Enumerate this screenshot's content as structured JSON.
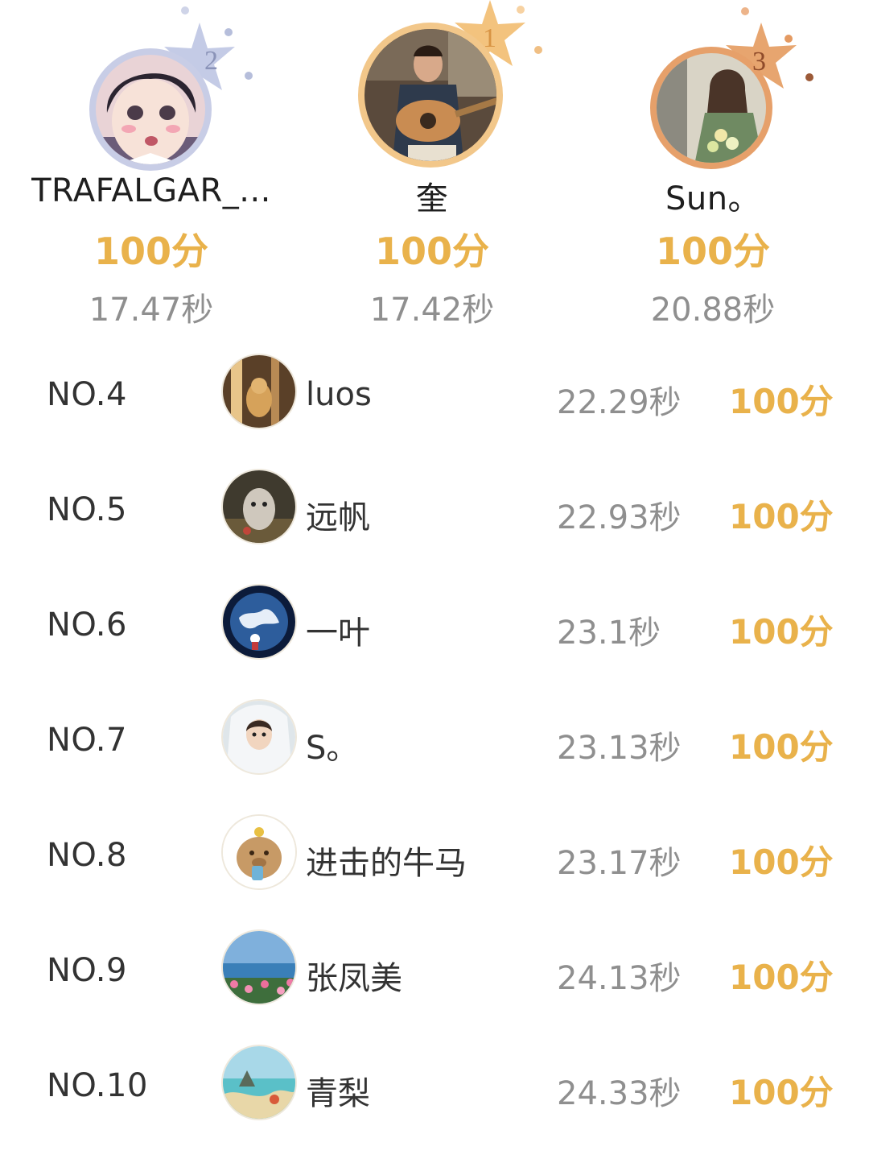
{
  "podium": [
    {
      "rank": "2",
      "name": "TRAFALGAR_...",
      "score": "100分",
      "time": "17.47秒"
    },
    {
      "rank": "1",
      "name": "奎",
      "score": "100分",
      "time": "17.42秒"
    },
    {
      "rank": "3",
      "name": "Sun。",
      "score": "100分",
      "time": "20.88秒"
    }
  ],
  "list": [
    {
      "no": "NO.4",
      "name": "luos",
      "time": "22.29秒",
      "score": "100分"
    },
    {
      "no": "NO.5",
      "name": "远帆",
      "time": "22.93秒",
      "score": "100分"
    },
    {
      "no": "NO.6",
      "name": "一叶",
      "time": "23.1秒",
      "score": "100分"
    },
    {
      "no": "NO.7",
      "name": "S。",
      "time": "23.13秒",
      "score": "100分"
    },
    {
      "no": "NO.8",
      "name": "进击的牛马",
      "time": "23.17秒",
      "score": "100分"
    },
    {
      "no": "NO.9",
      "name": "张凤美",
      "time": "24.13秒",
      "score": "100分"
    },
    {
      "no": "NO.10",
      "name": "青梨",
      "time": "24.33秒",
      "score": "100分"
    }
  ],
  "colors": {
    "score": "#e9b24b",
    "time": "#8f8f8f",
    "text": "#333333",
    "gold": "#f1b565",
    "silver": "#b9c1dc",
    "bronze": "#e59d62"
  },
  "icons": {
    "silver_badge": "star-badge-silver-icon",
    "gold_badge": "star-badge-gold-icon",
    "bronze_badge": "star-badge-bronze-icon"
  }
}
